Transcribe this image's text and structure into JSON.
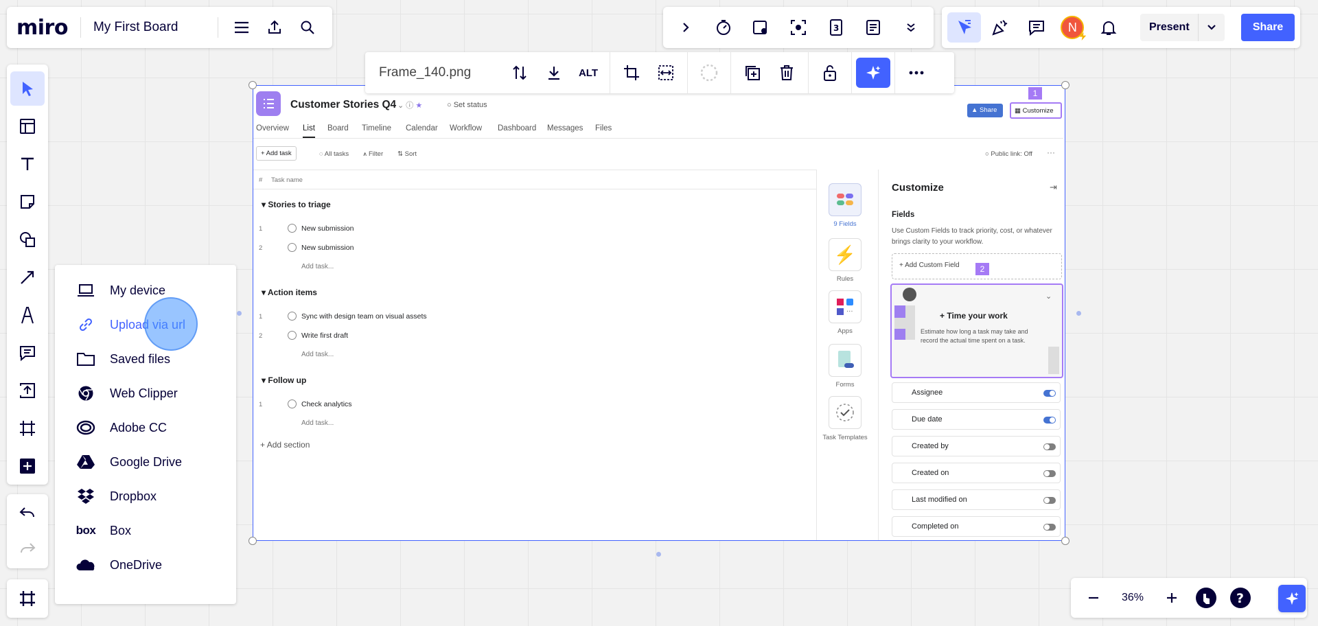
{
  "app": {
    "logo": "miro",
    "board_title": "My First Board"
  },
  "topbar": {
    "present_label": "Present",
    "share_label": "Share",
    "avatar_initial": "N"
  },
  "context_toolbar": {
    "file_name": "Frame_140.png",
    "alt_label": "ALT"
  },
  "upload_menu": {
    "items": [
      {
        "label": "My device",
        "icon": "laptop-icon"
      },
      {
        "label": "Upload via url",
        "icon": "link-icon"
      },
      {
        "label": "Saved files",
        "icon": "folder-icon"
      },
      {
        "label": "Web Clipper",
        "icon": "chrome-icon"
      },
      {
        "label": "Adobe CC",
        "icon": "adobe-cc-icon"
      },
      {
        "label": "Google Drive",
        "icon": "google-drive-icon"
      },
      {
        "label": "Dropbox",
        "icon": "dropbox-icon"
      },
      {
        "label": "Box",
        "icon": "box-logo"
      },
      {
        "label": "OneDrive",
        "icon": "onedrive-icon"
      }
    ]
  },
  "zoom": {
    "level": "36%"
  },
  "image": {
    "project_title": "Customer Stories Q4",
    "set_status": "Set status",
    "share": "Share",
    "customize": "Customize",
    "badge1": "1",
    "badge2": "2",
    "tabs": [
      "Overview",
      "List",
      "Board",
      "Timeline",
      "Calendar",
      "Workflow",
      "Dashboard",
      "Messages",
      "Files"
    ],
    "toolbar": {
      "add_task": "+ Add task",
      "all_tasks": "All tasks",
      "filter": "Filter",
      "sort": "Sort",
      "public_link": "Public link: Off"
    },
    "columns": {
      "num": "#",
      "task_name": "Task name"
    },
    "sections": [
      {
        "name": "Stories to triage",
        "tasks": [
          "New submission",
          "New submission"
        ]
      },
      {
        "name": "Action items",
        "tasks": [
          "Sync with design team on visual assets",
          "Write first draft"
        ]
      },
      {
        "name": "Follow up",
        "tasks": [
          "Check analytics"
        ]
      }
    ],
    "add_task_label": "Add task...",
    "add_section": "Add section",
    "sidebar": [
      {
        "label": "9 Fields"
      },
      {
        "label": "Rules"
      },
      {
        "label": "Apps"
      },
      {
        "label": "Forms"
      },
      {
        "label": "Task Templates"
      }
    ],
    "customize_panel": {
      "title": "Customize",
      "fields_heading": "Fields",
      "fields_desc": "Use Custom Fields to track priority, cost, or whatever brings clarity to your workflow.",
      "add_custom_field": "Add Custom Field",
      "time_title": "Time your work",
      "time_desc": "Estimate how long a task may take and record the actual time spent on a task.",
      "field_rows": [
        {
          "label": "Assignee",
          "on": true
        },
        {
          "label": "Due date",
          "on": true
        },
        {
          "label": "Created by",
          "on": false
        },
        {
          "label": "Created on",
          "on": false
        },
        {
          "label": "Last modified on",
          "on": false
        },
        {
          "label": "Completed on",
          "on": false
        }
      ]
    }
  }
}
